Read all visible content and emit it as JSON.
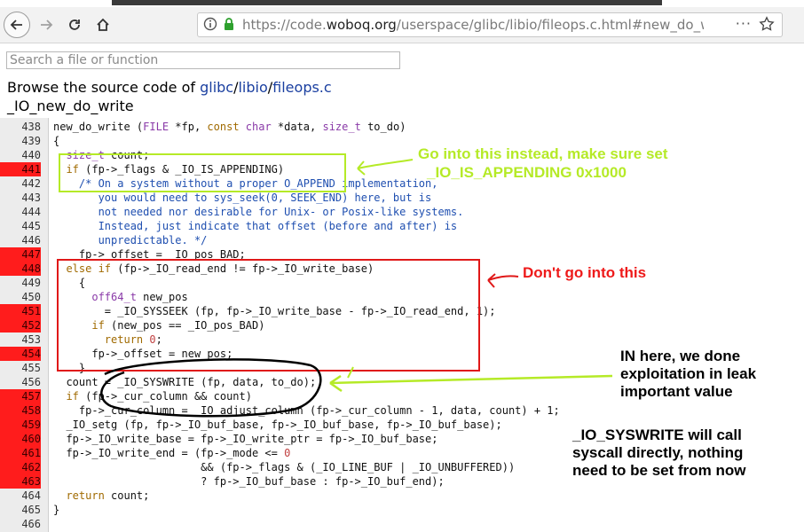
{
  "browser": {
    "url_prefix": "https://code.",
    "url_domain": "woboq.org",
    "url_path": "/userspace/glibc/libio/fileops.c.html#new_do_w",
    "more_label": "···",
    "icons": [
      "back-arrow-icon",
      "forward-arrow-icon",
      "reload-icon",
      "home-icon",
      "info-icon",
      "lock-icon",
      "star-icon"
    ]
  },
  "search": {
    "placeholder": "Search a file or function"
  },
  "header": {
    "browse_prefix": "Browse the source code of ",
    "crumb1": "glibc",
    "crumb2": "libio",
    "crumb3": "fileops.c",
    "sep": "/",
    "function_name": "_IO_new_do_write"
  },
  "code": [
    {
      "n": "438",
      "hot": false,
      "html": "new_do_write (<span class='ty'>FILE</span> *fp, <span class='kw'>const</span> <span class='ty'>char</span> *data, <span class='ty'>size_t</span> to_do)"
    },
    {
      "n": "439",
      "hot": false,
      "html": "{"
    },
    {
      "n": "440",
      "hot": false,
      "html": "  <span class='ty'>size_t</span> count;"
    },
    {
      "n": "441",
      "hot": true,
      "html": "  <span class='kw'>if</span> (fp-&gt;_flags &amp; _IO_IS_APPENDING)"
    },
    {
      "n": "442",
      "hot": false,
      "html": "    <span class='cm'>/* On a system without a proper O_APPEND implementation,</span>"
    },
    {
      "n": "443",
      "hot": false,
      "html": "<span class='cm'>       you would need to sys_seek(0, SEEK_END) here, but is</span>"
    },
    {
      "n": "444",
      "hot": false,
      "html": "<span class='cm'>       not needed nor desirable for Unix- or Posix-like systems.</span>"
    },
    {
      "n": "445",
      "hot": false,
      "html": "<span class='cm'>       Instead, just indicate that offset (before and after) is</span>"
    },
    {
      "n": "446",
      "hot": false,
      "html": "<span class='cm'>       unpredictable. */</span>"
    },
    {
      "n": "447",
      "hot": true,
      "html": "    fp-&gt;_offset = _IO_pos_BAD;"
    },
    {
      "n": "448",
      "hot": true,
      "html": "  <span class='kw'>else if</span> (fp-&gt;_IO_read_end != fp-&gt;_IO_write_base)"
    },
    {
      "n": "449",
      "hot": false,
      "html": "    {"
    },
    {
      "n": "450",
      "hot": false,
      "html": "      <span class='ty'>off64_t</span> new_pos"
    },
    {
      "n": "451",
      "hot": true,
      "html": "        = _IO_SYSSEEK (fp, fp-&gt;_IO_write_base - fp-&gt;_IO_read_end, 1);"
    },
    {
      "n": "452",
      "hot": true,
      "html": "      <span class='kw'>if</span> (new_pos == _IO_pos_BAD)"
    },
    {
      "n": "453",
      "hot": false,
      "html": "        <span class='kw'>return</span> <span class='num'>0</span>;"
    },
    {
      "n": "454",
      "hot": true,
      "html": "      fp-&gt;_offset = new_pos;"
    },
    {
      "n": "455",
      "hot": false,
      "html": "    }"
    },
    {
      "n": "456",
      "hot": false,
      "html": "  count = _IO_SYSWRITE (fp, data, to_do);"
    },
    {
      "n": "457",
      "hot": true,
      "html": "  <span class='kw'>if</span> (fp-&gt;_cur_column &amp;&amp; count)"
    },
    {
      "n": "458",
      "hot": true,
      "html": "    fp-&gt;_cur_column = _IO_adjust_column (fp-&gt;_cur_column - 1, data, count) + 1;"
    },
    {
      "n": "459",
      "hot": true,
      "html": "  _IO_setg (fp, fp-&gt;_IO_buf_base, fp-&gt;_IO_buf_base, fp-&gt;_IO_buf_base);"
    },
    {
      "n": "460",
      "hot": true,
      "html": "  fp-&gt;_IO_write_base = fp-&gt;_IO_write_ptr = fp-&gt;_IO_buf_base;"
    },
    {
      "n": "461",
      "hot": true,
      "html": "  fp-&gt;_IO_write_end = (fp-&gt;_mode &lt;= <span class='num'>0</span>"
    },
    {
      "n": "462",
      "hot": true,
      "html": "                       &amp;&amp; (fp-&gt;_flags &amp; (_IO_LINE_BUF | _IO_UNBUFFERED))"
    },
    {
      "n": "463",
      "hot": true,
      "html": "                       ? fp-&gt;_IO_buf_base : fp-&gt;_IO_buf_end);"
    },
    {
      "n": "464",
      "hot": false,
      "html": "  <span class='kw'>return</span> count;"
    },
    {
      "n": "465",
      "hot": false,
      "html": "}"
    },
    {
      "n": "466",
      "hot": false,
      "html": ""
    }
  ],
  "annotations": {
    "green_line1": "Go into this instead, make sure set",
    "green_line2": "_IO_IS_APPENDING 0x1000",
    "red": "Don't go into this",
    "black1_line1": "IN here, we done",
    "black1_line2": "exploitation in leak",
    "black1_line3": "important value",
    "black2_line1": "_IO_SYSWRITE will call",
    "black2_line2": "syscall directly, nothing",
    "black2_line3": "need to be set from now"
  },
  "colors": {
    "hot_line": "#ff1c1c",
    "annotation_green": "#b5ea27",
    "annotation_red": "#ee1a1a",
    "link": "#1a3fa0"
  }
}
